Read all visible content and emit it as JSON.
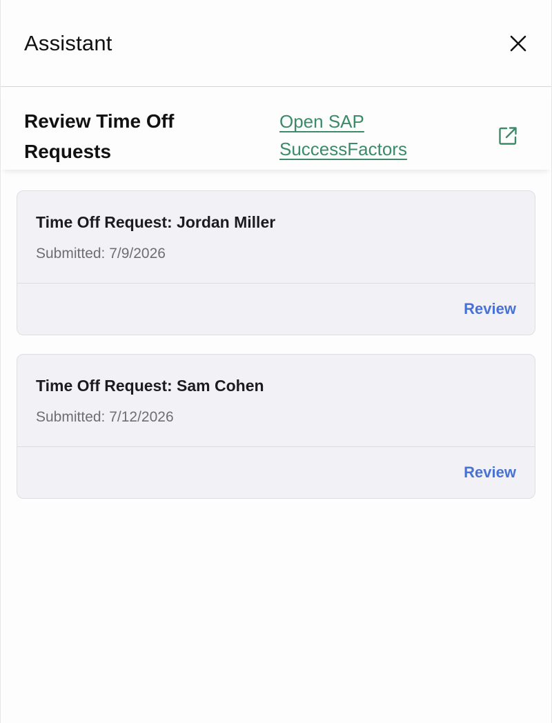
{
  "header": {
    "title": "Assistant",
    "close_icon": "close-icon"
  },
  "subheader": {
    "title": "Review Time Off Requests",
    "link_label": "Open SAP SuccessFactors",
    "link_icon": "external-link-icon",
    "link_color": "#3b8a68"
  },
  "requests": [
    {
      "title": "Time Off Request: Jordan Miller",
      "submitted": "Submitted: 7/9/2026",
      "action": "Review"
    },
    {
      "title": "Time Off Request: Sam Cohen",
      "submitted": "Submitted: 7/12/2026",
      "action": "Review"
    }
  ],
  "colors": {
    "accent": "#4a72d4",
    "card_bg": "#f2f2f6"
  }
}
